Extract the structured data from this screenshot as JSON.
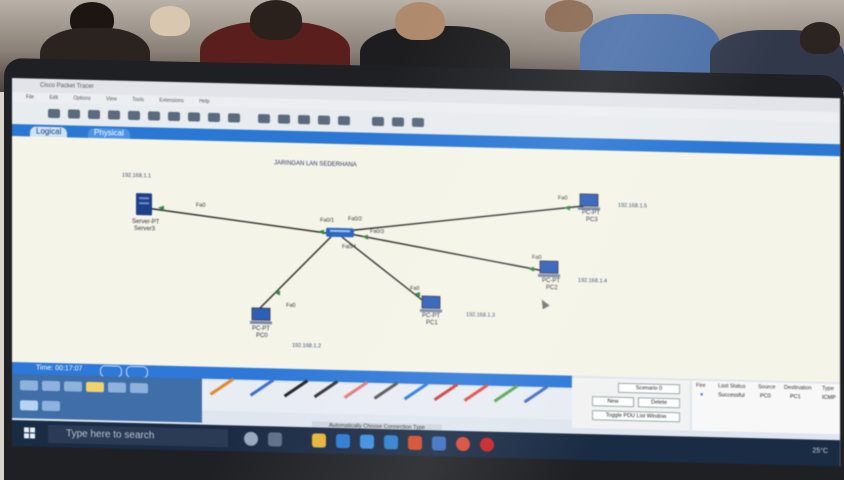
{
  "app": {
    "title": "Cisco Packet Tracer",
    "menu": [
      "File",
      "Edit",
      "Options",
      "View",
      "Tools",
      "Extensions",
      "Help"
    ]
  },
  "tabs": {
    "logical": "Logical",
    "physical": "Physical"
  },
  "workspace": {
    "banner": "JARINGAN LAN SEDERHANA",
    "devices": {
      "server": {
        "type": "Server-PT",
        "name": "Server3",
        "ip": "192.168.1.1"
      },
      "pc0": {
        "type": "PC-PT",
        "name": "PC0",
        "ip": "192.168.1.2"
      },
      "pc1": {
        "type": "PC-PT",
        "name": "PC1",
        "ip": "192.168.1.3"
      },
      "pc2": {
        "type": "PC-PT",
        "name": "PC2",
        "ip": "192.168.1.4"
      },
      "pc3": {
        "type": "PC-PT",
        "name": "PC3",
        "ip": "192.168.1.5"
      }
    },
    "ports": {
      "server_fa0": "Fa0",
      "sw_fa01": "Fa0/1",
      "sw_fa02": "Fa0/2",
      "sw_fa03": "Fa0/3",
      "sw_fa04": "Fa0/4",
      "pc0_fa0": "Fa0",
      "pc1_fa0": "Fa0",
      "pc2_fa0": "Fa0",
      "pc3_fa0": "Fa0"
    }
  },
  "bottom": {
    "time": "Time: 00:17:07",
    "auto_connection": "Automatically Choose Connection Type",
    "scenario": "Scenario 0",
    "new_btn": "New",
    "delete_btn": "Delete",
    "toggle_pdu": "Toggle PDU List Window",
    "pdu_headers": [
      "Fire",
      "Last Status",
      "Source",
      "Destination",
      "Type"
    ],
    "pdu_row": [
      "",
      "Successful",
      "PC0",
      "PC1",
      "ICMP"
    ]
  },
  "taskbar": {
    "search_placeholder": "Type here to search",
    "tray": "25°C"
  },
  "colors": {
    "accent": "#2d78d8",
    "link": "#2f8a3a",
    "cable": "#2b2b2b",
    "taskbar": "#1a2b44"
  }
}
